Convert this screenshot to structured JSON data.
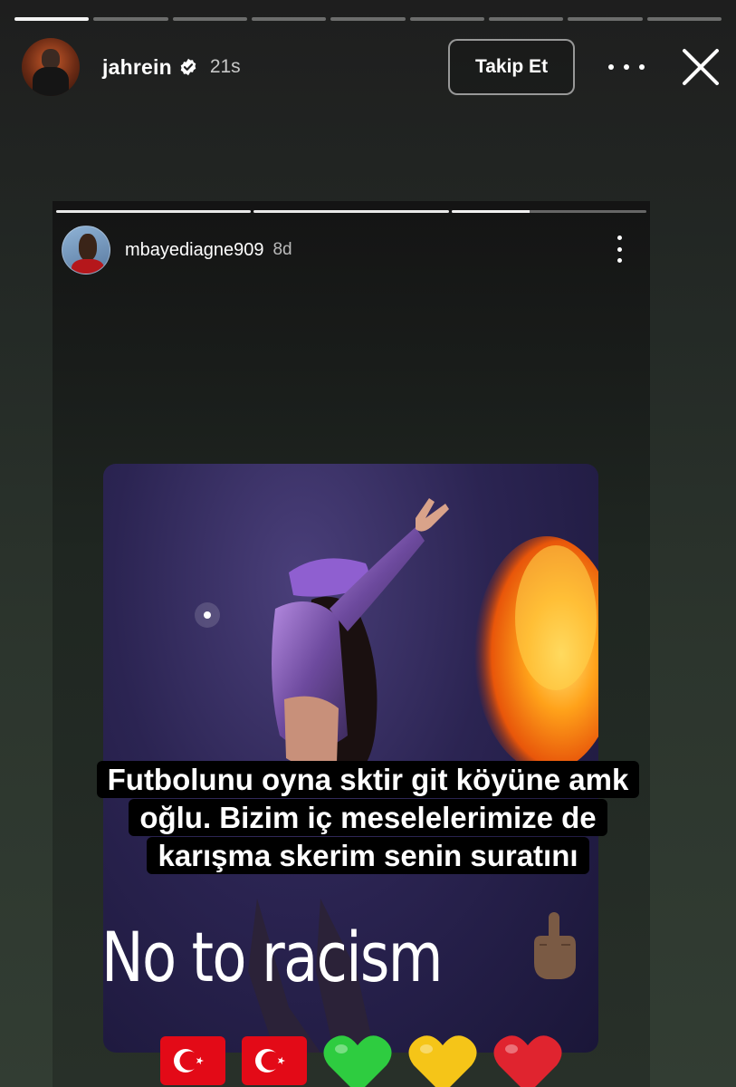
{
  "story": {
    "progress_segments": 9,
    "progress_completed": 1,
    "username": "jahrein",
    "verified_icon": "verified-badge-icon",
    "time": "21s",
    "follow_label": "Takip Et",
    "more_icon": "more-horizontal-icon",
    "close_icon": "close-icon"
  },
  "reshared": {
    "progress_segments": 3,
    "progress_completed": 2,
    "username": "mbayediagne909",
    "time": "8d",
    "more_icon": "more-vertical-icon",
    "image": "concert-performer-photo",
    "caption_lines": [
      "Futbolunu oyna sktir git köyüne amk",
      "oğlu. Bizim iç meselelerimize de",
      "karışma skerim senin suratını"
    ],
    "text_overlay": "No to racism",
    "stickers": [
      "turkey-flag-emoji",
      "turkey-flag-emoji",
      "green-heart-emoji",
      "yellow-heart-emoji",
      "red-heart-emoji",
      "middle-finger-emoji"
    ]
  },
  "colors": {
    "turkey_red": "#e30a17",
    "green_heart": "#2ecc40",
    "yellow_heart": "#f5c518",
    "red_heart": "#e0242f"
  }
}
